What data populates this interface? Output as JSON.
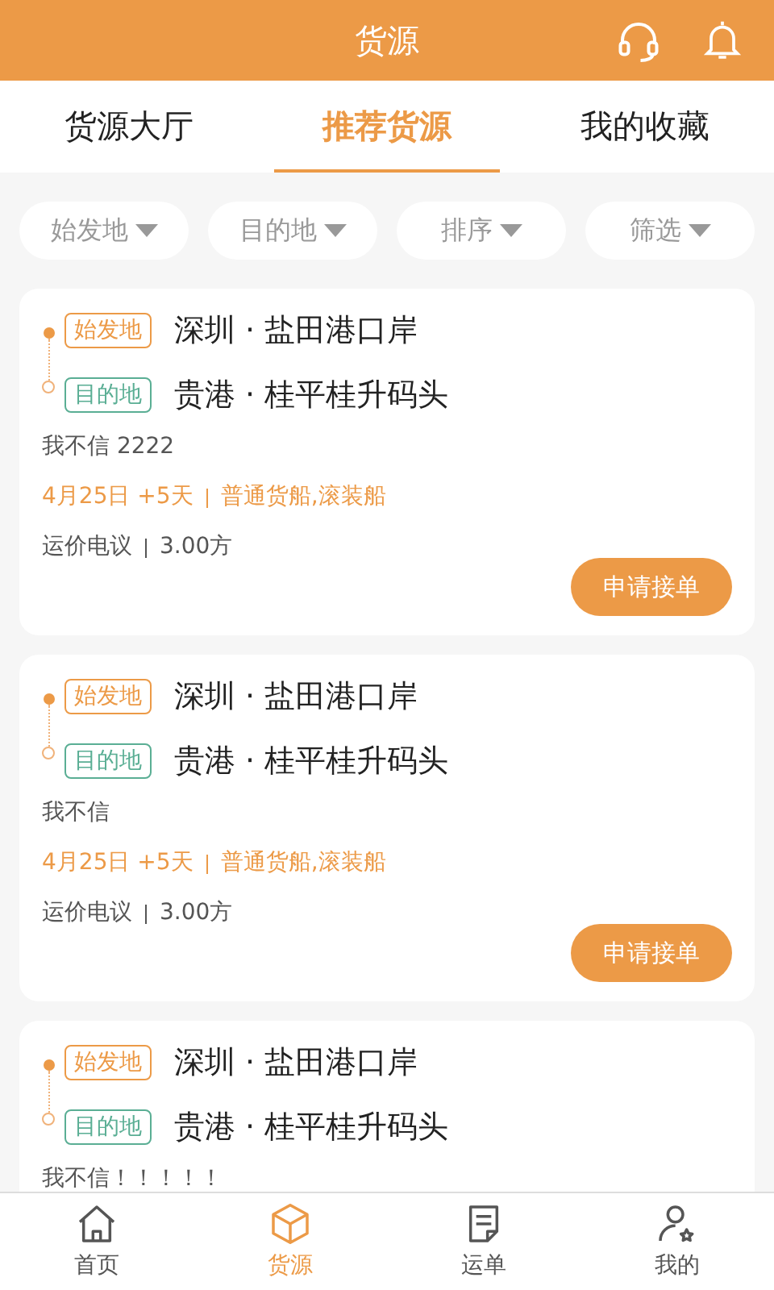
{
  "header": {
    "title": "货源"
  },
  "tabs": [
    {
      "label": "货源大厅",
      "selected": false
    },
    {
      "label": "推荐货源",
      "selected": true
    },
    {
      "label": "我的收藏",
      "selected": false
    }
  ],
  "filters": [
    {
      "label": "始发地"
    },
    {
      "label": "目的地"
    },
    {
      "label": "排序"
    },
    {
      "label": "筛选"
    }
  ],
  "cards": [
    {
      "origin_tag": "始发地",
      "origin": "深圳 · 盐田港口岸",
      "destination_tag": "目的地",
      "destination": "贵港 · 桂平桂升码头",
      "note": "我不信 2222",
      "date": "4月25日 +5天",
      "ship_types": "普通货船,滚装船",
      "price": "运价电议",
      "volume": "3.00方",
      "button": "申请接单"
    },
    {
      "origin_tag": "始发地",
      "origin": "深圳 · 盐田港口岸",
      "destination_tag": "目的地",
      "destination": "贵港 · 桂平桂升码头",
      "note": "我不信",
      "date": "4月25日 +5天",
      "ship_types": "普通货船,滚装船",
      "price": "运价电议",
      "volume": "3.00方",
      "button": "申请接单"
    },
    {
      "origin_tag": "始发地",
      "origin": "深圳 · 盐田港口岸",
      "destination_tag": "目的地",
      "destination": "贵港 · 桂平桂升码头",
      "note": "我不信！！！！！"
    }
  ],
  "bottom_nav": [
    {
      "kind": "home",
      "label": "首页",
      "selected": false
    },
    {
      "kind": "cargo",
      "label": "货源",
      "selected": true
    },
    {
      "kind": "waybill",
      "label": "运单",
      "selected": false
    },
    {
      "kind": "profile",
      "label": "我的",
      "selected": false
    }
  ]
}
